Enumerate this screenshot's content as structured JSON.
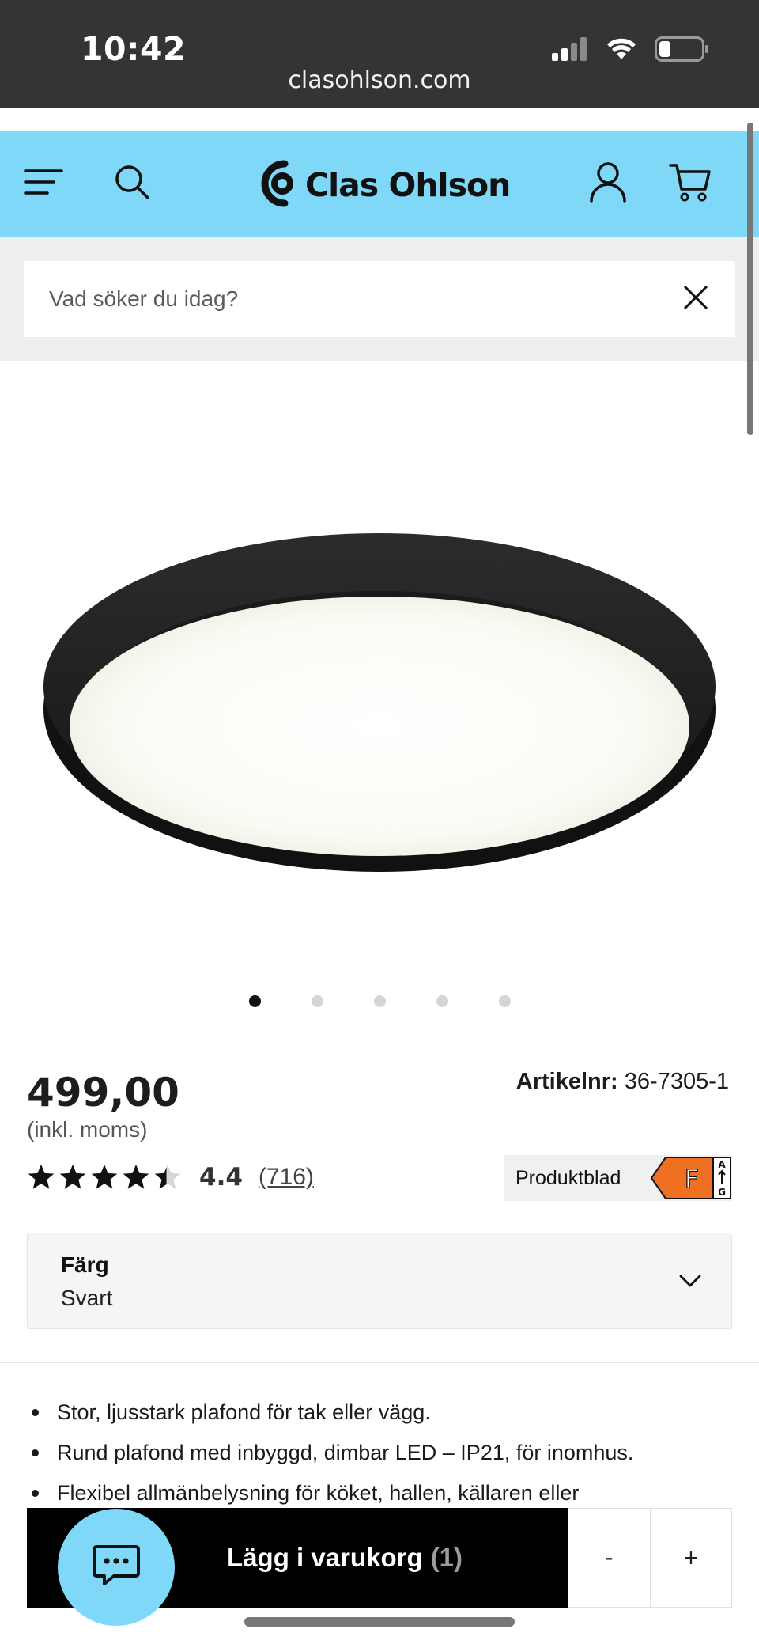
{
  "status_bar": {
    "time": "10:42",
    "url": "clasohlson.com",
    "icons": [
      "signal-icon",
      "wifi-icon",
      "battery-icon"
    ]
  },
  "header": {
    "brand": "Clas Ohlson",
    "bg_color": "#7fd8f8",
    "icons": [
      "menu-icon",
      "search-icon",
      "account-icon",
      "cart-icon"
    ]
  },
  "search": {
    "placeholder": "Vad söker du idag?",
    "value": ""
  },
  "gallery": {
    "image_count": 5,
    "active_index": 0
  },
  "product": {
    "price": "499,00",
    "price_note": "(inkl. moms)",
    "article_label": "Artikelnr:",
    "article_number": "36-7305-1",
    "rating_value": "4.4",
    "rating_stars": 4.4,
    "rating_count": "(716)",
    "produktblad_label": "Produktblad",
    "energy_class": "F",
    "energy_scale_top": "A",
    "energy_scale_bottom": "G",
    "energy_color": "#f07023"
  },
  "color_selector": {
    "label": "Färg",
    "value": "Svart"
  },
  "bullets": [
    "Stor, ljusstark plafond för tak eller vägg.",
    "Rund plafond med inbyggd, dimbar LED – IP21, för inomhus.",
    "Flexibel allmänbelysning för köket, hallen, källaren eller"
  ],
  "cart": {
    "add_label": "Lägg i varukorg",
    "quantity": "(1)",
    "minus": "-",
    "plus": "+"
  }
}
